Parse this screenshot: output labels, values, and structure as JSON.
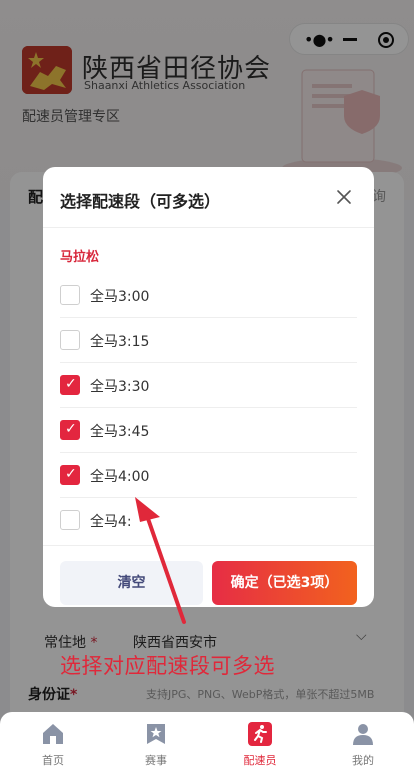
{
  "capsule": {
    "more_icon": "more-dots-icon",
    "minimize_icon": "minus-icon",
    "close_icon": "target-icon"
  },
  "header": {
    "org_name_cn": "陕西省田径协会",
    "org_name_en": "Shaanxi Athletics Association",
    "zone": "配速员管理专区"
  },
  "card": {
    "title_fragment": "配",
    "right_fragment": "询"
  },
  "form": {
    "residence_label": "常住地",
    "required_mark": "*",
    "residence_value": "陕西省西安市",
    "id_label": "身份证",
    "id_hint": "支持JPG、PNG、WebP格式，单张不超过5MB"
  },
  "modal": {
    "title": "选择配速段（可多选）",
    "group": "马拉松",
    "options": [
      {
        "label": "全马3:00",
        "checked": false
      },
      {
        "label": "全马3:15",
        "checked": false
      },
      {
        "label": "全马3:30",
        "checked": true
      },
      {
        "label": "全马3:45",
        "checked": true
      },
      {
        "label": "全马4:00",
        "checked": true
      },
      {
        "label": "全马4:",
        "checked": false
      }
    ],
    "clear_label": "清空",
    "confirm_label": "确定（已选3项）"
  },
  "annotation": "选择对应配速段可多选",
  "tabbar": [
    {
      "label": "首页",
      "icon": "home-icon",
      "active": false
    },
    {
      "label": "赛事",
      "icon": "star-badge-icon",
      "active": false
    },
    {
      "label": "配速员",
      "icon": "runner-icon",
      "active": true
    },
    {
      "label": "我的",
      "icon": "user-icon",
      "active": false
    }
  ],
  "colors": {
    "accent": "#e3263f",
    "gradient_end": "#f2621e",
    "group_label": "#d8283c"
  }
}
